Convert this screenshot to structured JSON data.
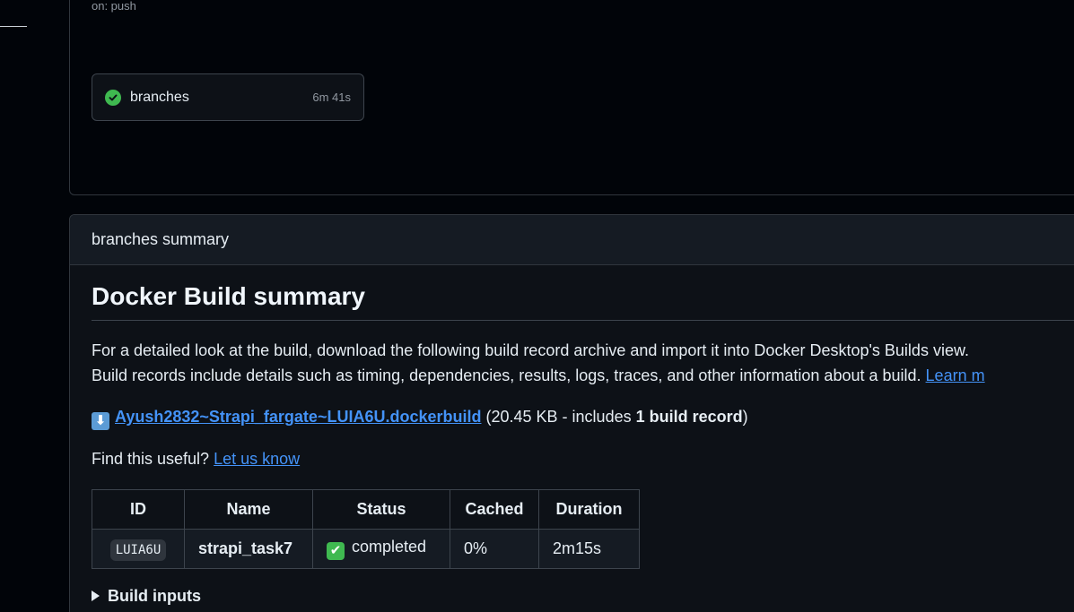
{
  "workflow": {
    "trigger": "on: push",
    "job": {
      "name": "branches",
      "duration": "6m 41s",
      "status_icon": "check-circle-icon",
      "status_color": "#3fb950"
    }
  },
  "summary": {
    "header": "branches summary",
    "title": "Docker Build summary",
    "para1_line1": "For a detailed look at the build, download the following build record archive and import it into Docker Desktop's Builds view.",
    "para1_line2": "Build records include details such as timing, dependencies, results, logs, traces, and other information about a build.",
    "learn_more": "Learn m",
    "download": {
      "icon": "⬇",
      "filename": "Ayush2832~Strapi_fargate~LUIA6U.dockerbuild",
      "size_prefix": "(20.45 KB - includes ",
      "records": "1 build record",
      "size_suffix": ")"
    },
    "feedback": {
      "text": "Find this useful? ",
      "link": "Let us know"
    },
    "table": {
      "headers": [
        "ID",
        "Name",
        "Status",
        "Cached",
        "Duration"
      ],
      "rows": [
        {
          "id": "LUIA6U",
          "name": "strapi_task7",
          "status_icon": "✔",
          "status": "completed",
          "cached": "0%",
          "duration": "2m15s"
        }
      ]
    },
    "details": {
      "label": "Build inputs"
    }
  },
  "colors": {
    "background": "#010409",
    "panel": "#0d1117",
    "link": "#4493f8",
    "success": "#3fb950"
  }
}
